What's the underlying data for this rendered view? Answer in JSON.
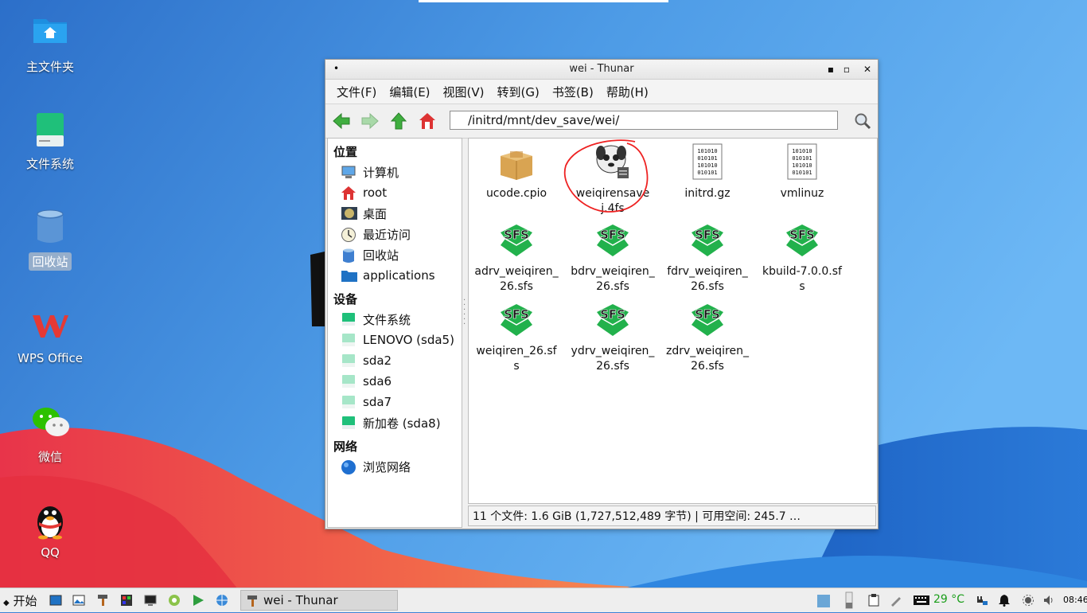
{
  "desktop": {
    "icons": [
      {
        "label": "主文件夹"
      },
      {
        "label": "文件系统"
      },
      {
        "label": "回收站"
      },
      {
        "label": "WPS Office"
      },
      {
        "label": "微信"
      },
      {
        "label": "QQ"
      }
    ]
  },
  "window": {
    "title": "wei - Thunar",
    "menu": [
      "文件(F)",
      "编辑(E)",
      "视图(V)",
      "转到(G)",
      "书签(B)",
      "帮助(H)"
    ],
    "address": "/initrd/mnt/dev_save/wei/",
    "sidebar": {
      "places_header": "位置",
      "places": [
        "计算机",
        "root",
        "桌面",
        "最近访问",
        "回收站",
        "applications"
      ],
      "devices_header": "设备",
      "devices": [
        "文件系统",
        "LENOVO (sda5)",
        "sda2",
        "sda6",
        "sda7",
        "新加卷 (sda8)"
      ],
      "network_header": "网络",
      "network": [
        "浏览网络"
      ]
    },
    "files": [
      {
        "line1": "ucode.cpio",
        "line2": ""
      },
      {
        "line1": "weiqirensave",
        "line2": "j.4fs"
      },
      {
        "line1": "initrd.gz",
        "line2": ""
      },
      {
        "line1": "vmlinuz",
        "line2": ""
      },
      {
        "line1": "adrv_weiqiren_",
        "line2": "26.sfs"
      },
      {
        "line1": "bdrv_weiqiren_",
        "line2": "26.sfs"
      },
      {
        "line1": "fdrv_weiqiren_",
        "line2": "26.sfs"
      },
      {
        "line1": "kbuild-7.0.0.sf",
        "line2": "s"
      },
      {
        "line1": "weiqiren_26.sf",
        "line2": "s"
      },
      {
        "line1": "ydrv_weiqiren_",
        "line2": "26.sfs"
      },
      {
        "line1": "zdrv_weiqiren_",
        "line2": "26.sfs"
      }
    ],
    "sfs_label": "SFS",
    "binary_text": "101010\n010101\n101010\n010101",
    "status": "11 个文件: 1.6 GiB (1,727,512,489 字节)  |  可用空间: 245.7 …"
  },
  "taskbar": {
    "start_label": "开始",
    "task_label": "wei - Thunar",
    "temperature": "29 °C",
    "clock": "08:46"
  },
  "colors": {
    "accent": "#1f72c4",
    "sfs_green": "#22b14c",
    "temp_green": "#1a9e1a"
  }
}
